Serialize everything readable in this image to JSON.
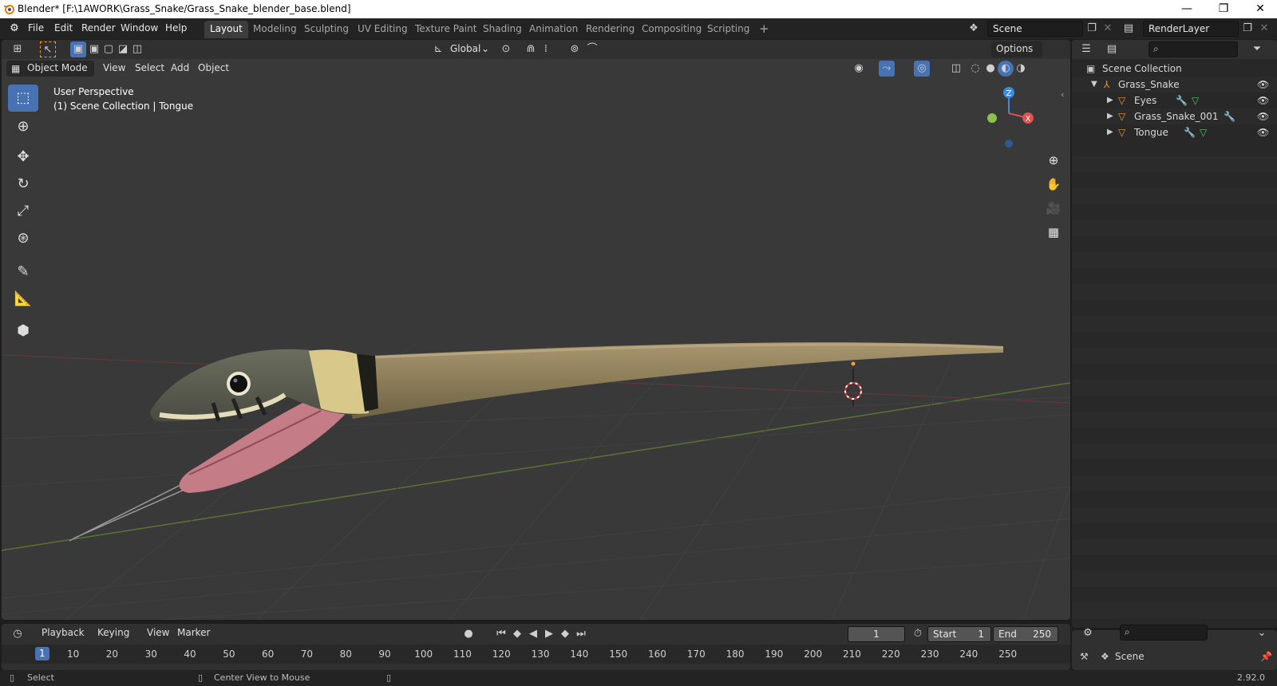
{
  "window": {
    "title": "Blender* [F:\\1AWORK\\Grass_Snake/Grass_Snake_blender_base.blend]",
    "minimize": "—",
    "maximize": "❐",
    "close": "✕"
  },
  "menu": [
    "File",
    "Edit",
    "Render",
    "Window",
    "Help"
  ],
  "workspaces": [
    "Layout",
    "Modeling",
    "Sculpting",
    "UV Editing",
    "Texture Paint",
    "Shading",
    "Animation",
    "Rendering",
    "Compositing",
    "Scripting"
  ],
  "workspace_add": "+",
  "scene_field": "Scene",
  "renderlayer_field": "RenderLayer",
  "viewport": {
    "mode": "Object Mode",
    "menus": [
      "View",
      "Select",
      "Add",
      "Object"
    ],
    "orientation": "Global",
    "options": "Options",
    "perspective": "User Perspective",
    "collection_info": "(1) Scene Collection | Tongue"
  },
  "gizmo": {
    "z": "Z",
    "x": "X"
  },
  "outliner": {
    "root": "Scene Collection",
    "items": [
      {
        "label": "Grass_Snake",
        "level": 1,
        "icon": "armature-icon"
      },
      {
        "label": "Eyes",
        "level": 2,
        "icon": "mesh-icon"
      },
      {
        "label": "Grass_Snake_001",
        "level": 2,
        "icon": "mesh-icon"
      },
      {
        "label": "Tongue",
        "level": 2,
        "icon": "mesh-icon"
      }
    ]
  },
  "timeline": {
    "menus": [
      "Playback",
      "Keying",
      "View",
      "Marker"
    ],
    "current_frame": "1",
    "start_label": "Start",
    "start": "1",
    "end_label": "End",
    "end": "250",
    "ticks": [
      "1",
      "10",
      "20",
      "30",
      "40",
      "50",
      "60",
      "70",
      "80",
      "90",
      "100",
      "110",
      "120",
      "130",
      "140",
      "150",
      "160",
      "170",
      "180",
      "190",
      "200",
      "210",
      "220",
      "230",
      "240",
      "250"
    ]
  },
  "properties": {
    "scene": "Scene"
  },
  "status": {
    "select": "Select",
    "center_view": "Center View to Mouse",
    "version": "2.92.0"
  },
  "colors": {
    "accent": "#4772b3",
    "x_axis": "#e05050",
    "y_axis": "#8bc34a",
    "z_axis": "#3d8be0"
  }
}
